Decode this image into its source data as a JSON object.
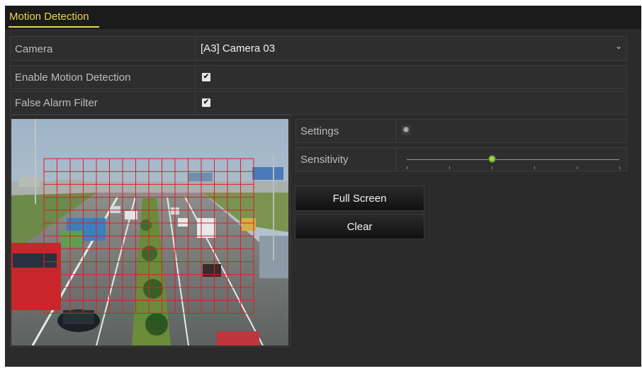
{
  "window": {
    "title": "Motion Detection"
  },
  "camera": {
    "label": "Camera",
    "value": "[A3] Camera 03"
  },
  "enable_motion_detection": {
    "label": "Enable Motion Detection",
    "checked": true
  },
  "false_alarm_filter": {
    "label": "False Alarm Filter",
    "checked": true
  },
  "settings": {
    "label": "Settings",
    "icon": "gear-icon"
  },
  "sensitivity": {
    "label": "Sensitivity",
    "level": 0.4
  },
  "buttons": {
    "full_screen": "Full Screen",
    "clear": "Clear"
  },
  "colors": {
    "accent": "#e8d84a",
    "grid": "#d8202a",
    "panel": "#2b2b2b"
  }
}
